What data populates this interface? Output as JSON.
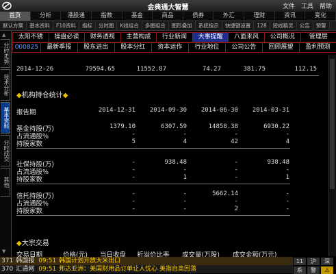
{
  "app": {
    "title": "金典通大智慧"
  },
  "window_menu": [
    "文件",
    "工具",
    "帮助"
  ],
  "nav": [
    "首页",
    "分析",
    "港股通",
    "指数",
    "基金",
    "商品",
    "债券",
    "外汇",
    "理财",
    "资讯",
    "变化"
  ],
  "toolbar": [
    "默认方案",
    "基本资料",
    "F10资料",
    "指标",
    "分时图",
    "K线组合",
    "多图组合",
    "图形叠加",
    "系统指示",
    "快捷键设置",
    "128",
    "短线精灵",
    "公告",
    "预警"
  ],
  "side_tabs": [
    "分时走势",
    "技术分析",
    "基本资料",
    "分时成交",
    "其他"
  ],
  "f10_row1": [
    "太阳不锈",
    "操盘必读",
    "财务透视",
    "主营构成",
    "行业新闻",
    "大事提醒",
    "八面来风",
    "公司概况",
    "管理层"
  ],
  "f10_row2": [
    "000825",
    "最新季报",
    "股东进出",
    "股本分红",
    "资本运作",
    "行业地位",
    "公司公告",
    "回顾展望",
    "盈利预测"
  ],
  "top_row": [
    "2014-12-26",
    "79594.65",
    "11552.87",
    "74.27",
    "381.75",
    "112.15"
  ],
  "inst_title": "机构持仓统计",
  "report_period": {
    "label": "报告期",
    "dates": [
      "2014-12-31",
      "2014-09-30",
      "2014-06-30",
      "2014-03-31"
    ]
  },
  "groups": [
    {
      "rows": [
        {
          "label": "基金持股(万)",
          "values": [
            "1379.10",
            "6307.59",
            "14858.38",
            "6930.22"
          ]
        },
        {
          "label": "占流通股%",
          "values": [
            "-",
            "-",
            "-",
            "-"
          ]
        },
        {
          "label": "持股家数",
          "values": [
            "5",
            "4",
            "42",
            "4"
          ]
        }
      ]
    },
    {
      "rows": [
        {
          "label": "社保持股(万)",
          "values": [
            "-",
            "938.48",
            "-",
            "938.48"
          ]
        },
        {
          "label": "占流通股%",
          "values": [
            "-",
            "-",
            "-",
            "-"
          ]
        },
        {
          "label": "持股家数",
          "values": [
            "-",
            "1",
            "-",
            "1"
          ]
        }
      ]
    },
    {
      "rows": [
        {
          "label": "信托持股(万)",
          "values": [
            "-",
            "-",
            "5662.14",
            "-"
          ]
        },
        {
          "label": "占流通股%",
          "values": [
            "-",
            "-",
            "-",
            "-"
          ]
        },
        {
          "label": "持股家数",
          "values": [
            "-",
            "-",
            "2",
            "-"
          ]
        }
      ]
    }
  ],
  "block_title": "大宗交易",
  "block_headers": [
    "交易日期",
    "价格(元)",
    "当日收盘",
    "折溢价比率",
    "成交量(万股)",
    "成交金额(万元)"
  ],
  "news": [
    {
      "id": "371",
      "tag": "韩国报",
      "time": "09:51",
      "text": "韩国计划开放大米出口"
    },
    {
      "id": "370",
      "tag": "汇通网",
      "time": "09:51",
      "text": "邦达亚洲：美国财用品订单让人忧心 美指自高回落"
    }
  ],
  "tray": [
    "11",
    "沪",
    "深",
    "系",
    "警",
    "⚠"
  ]
}
